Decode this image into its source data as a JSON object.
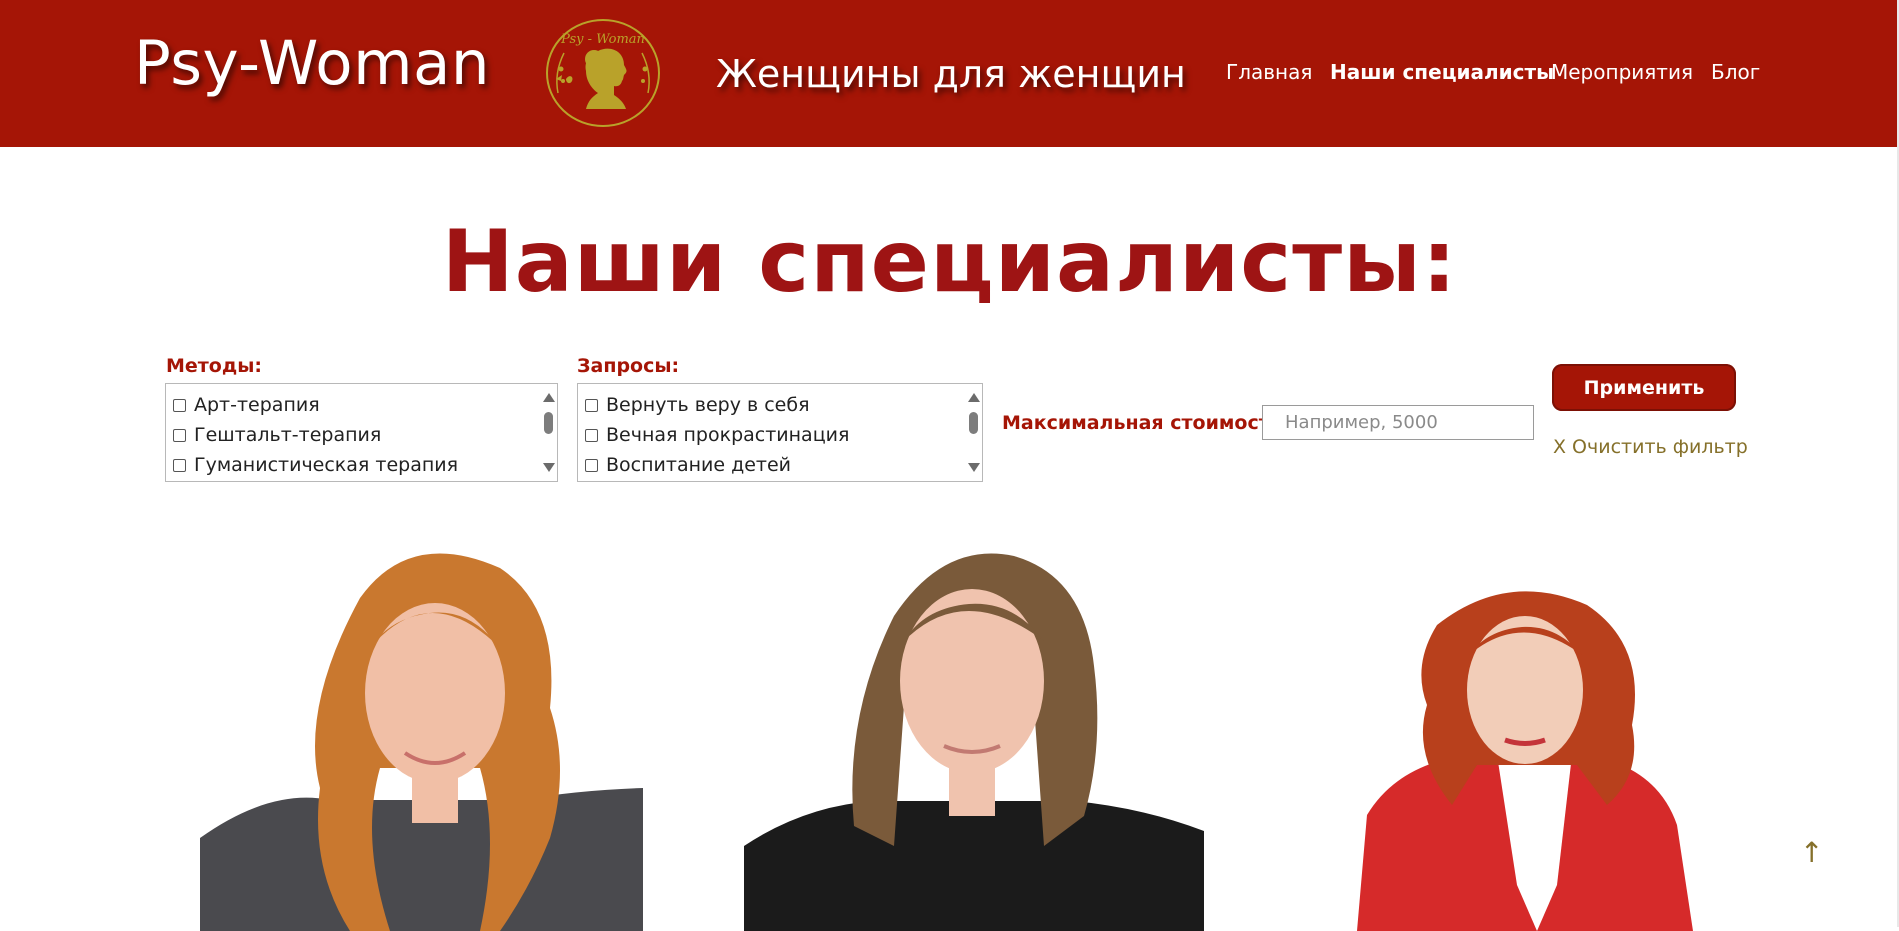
{
  "header": {
    "logo": "Psy-Woman",
    "emblem_text": "Psy - Woman",
    "tagline": "Женщины для женщин",
    "nav": [
      {
        "label": "Главная",
        "active": false
      },
      {
        "label": "Наши специалисты",
        "active": true
      },
      {
        "label": "Мероприятия",
        "active": false
      },
      {
        "label": "Блог",
        "active": false
      }
    ]
  },
  "page": {
    "title": "Наши специалисты:"
  },
  "filters": {
    "methods": {
      "label": "Методы:",
      "options": [
        "Арт-терапия",
        "Гештальт-терапия",
        "Гуманистическая терапия"
      ]
    },
    "requests": {
      "label": "Запросы:",
      "options": [
        "Вернуть веру в себя",
        "Вечная прокрастинация",
        "Воспитание детей"
      ]
    },
    "price": {
      "label": "Максимальная стоимость",
      "placeholder": "Например, 5000",
      "value": ""
    },
    "apply_label": "Применить",
    "clear_label": "X Очистить фильтр"
  },
  "scroll_top": "↑",
  "colors": {
    "brand_red": "#a51506",
    "title_red": "#9e1414",
    "gold": "#85702a",
    "emblem_gold": "#b9a22a"
  }
}
